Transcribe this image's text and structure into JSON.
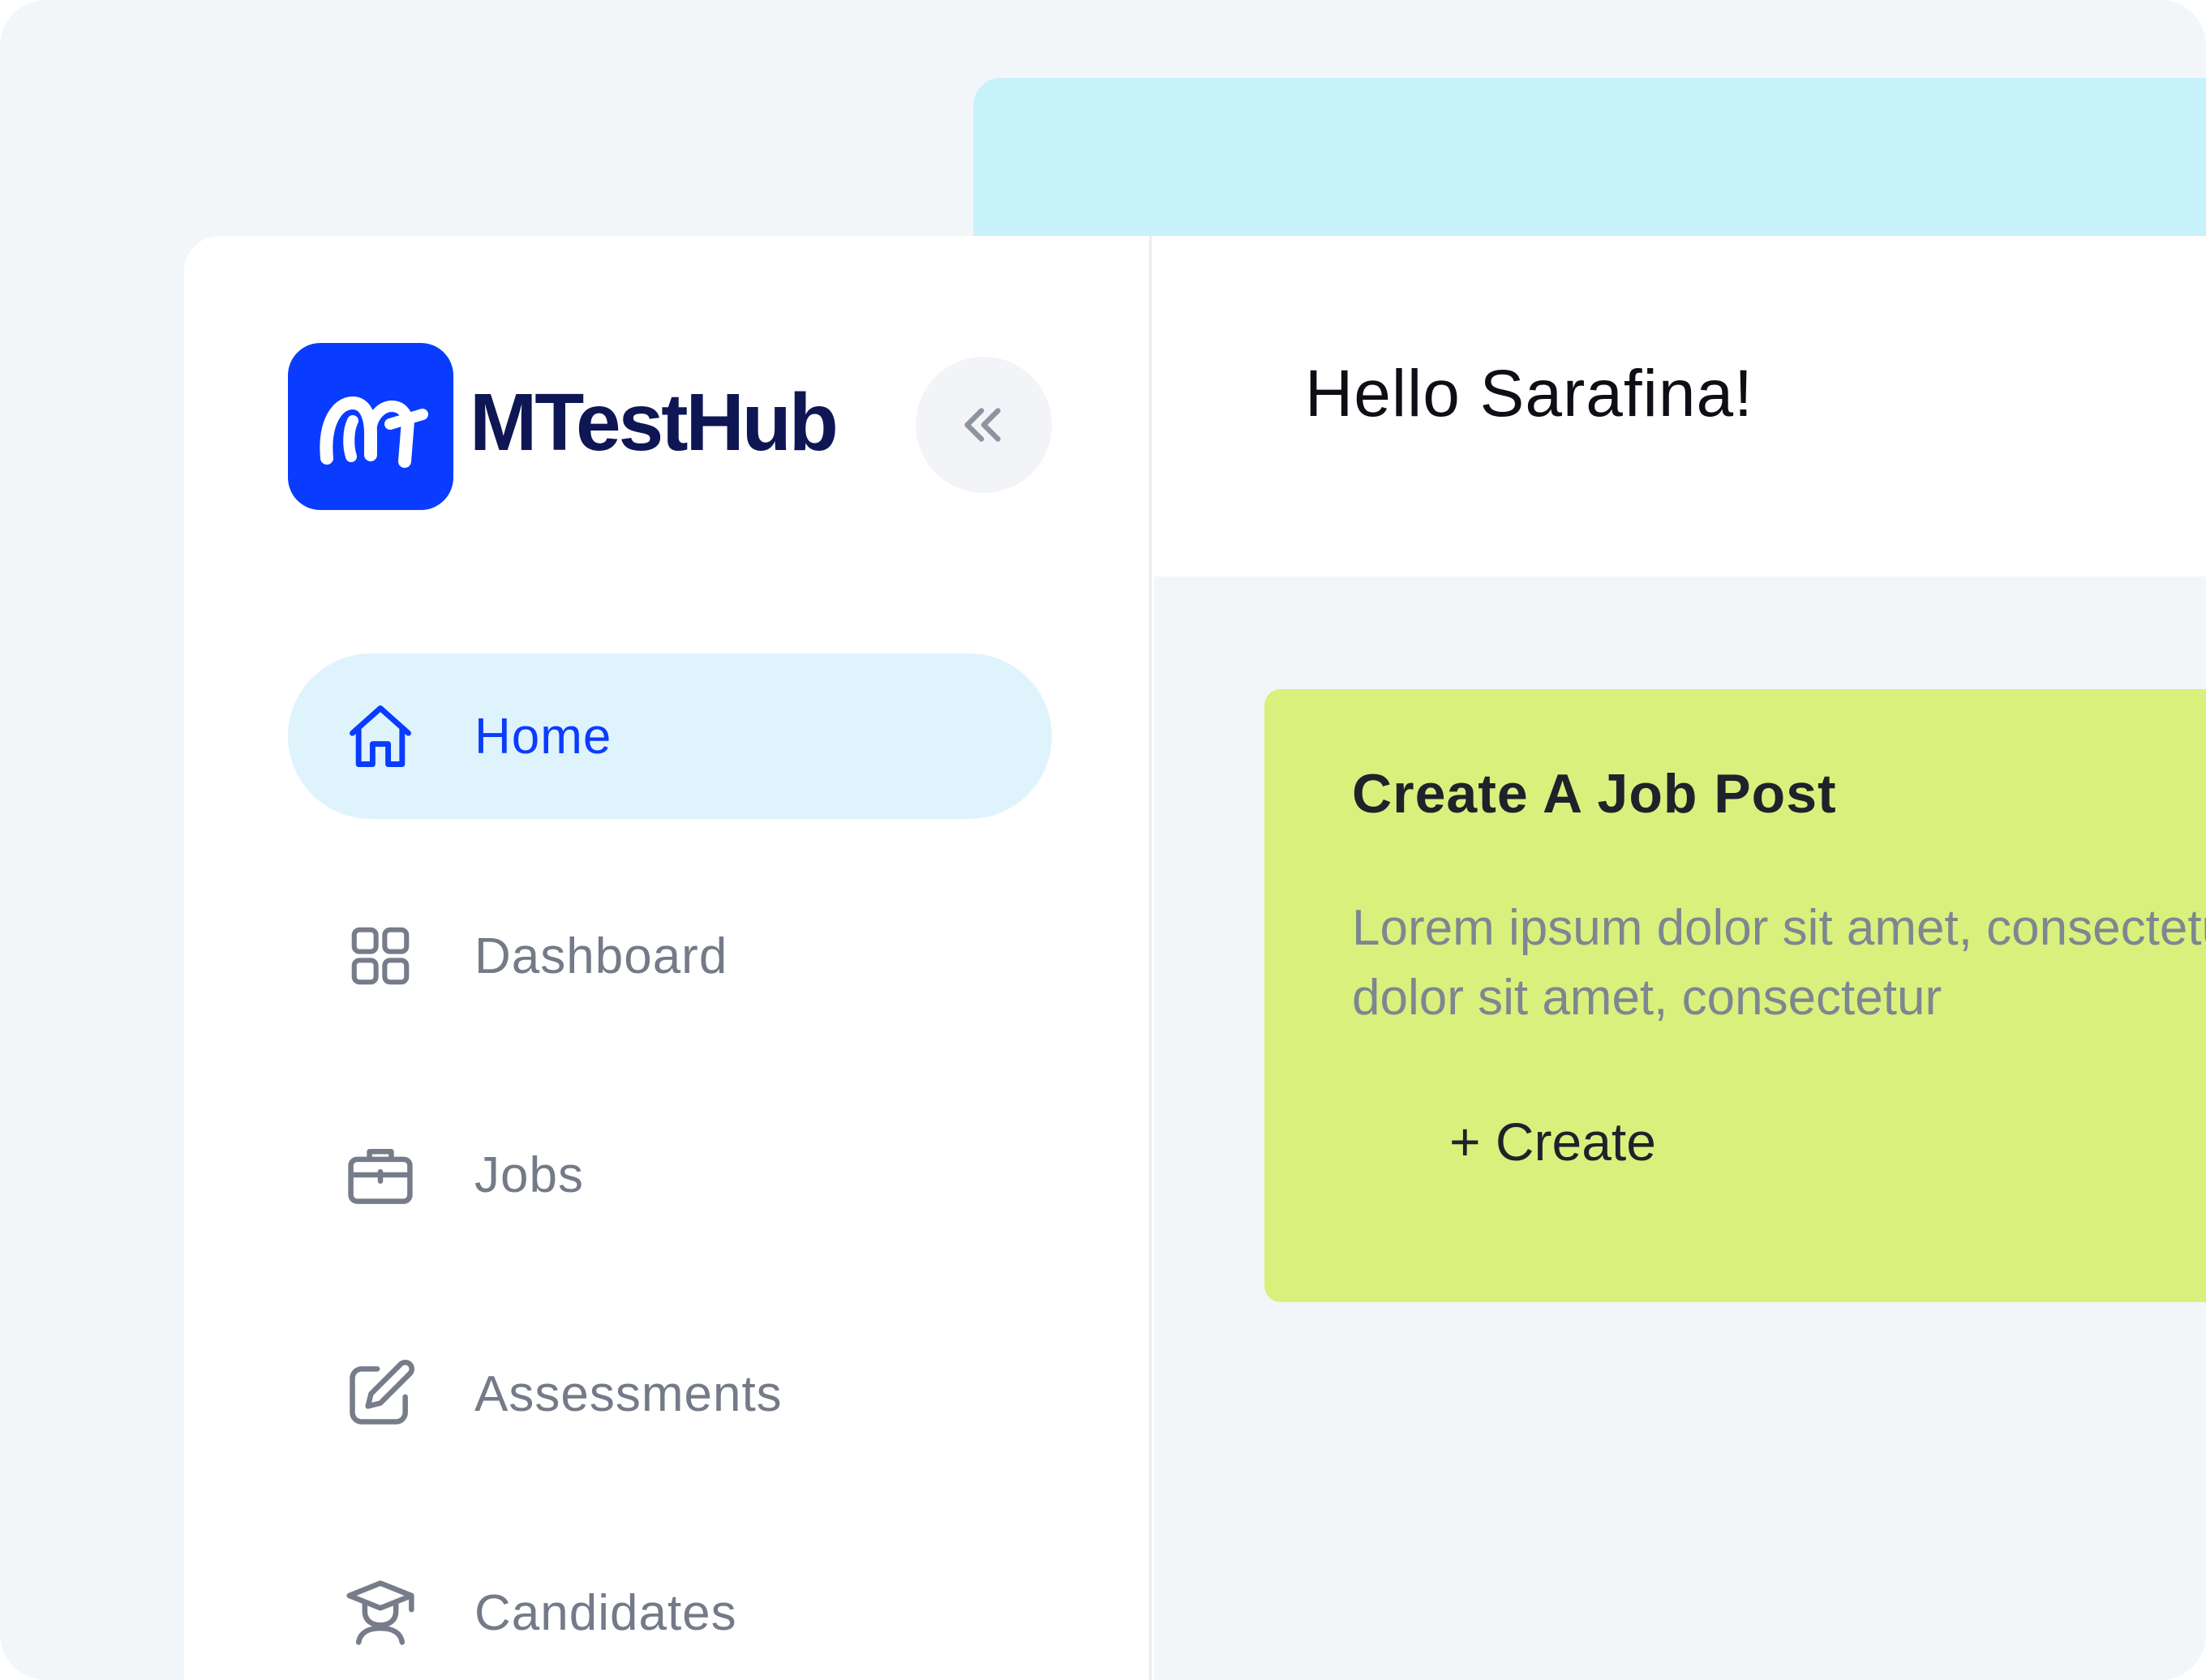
{
  "brand": {
    "name": "MTestHub",
    "icon": "mt-logo-icon",
    "color": "#0a3cff"
  },
  "sidebar": {
    "collapse_icon": "double-chevron-left-icon",
    "items": [
      {
        "label": "Home",
        "icon": "home-icon",
        "active": true
      },
      {
        "label": "Dashboard",
        "icon": "dashboard-grid-icon",
        "active": false
      },
      {
        "label": "Jobs",
        "icon": "briefcase-icon",
        "active": false
      },
      {
        "label": "Assessments",
        "icon": "edit-icon",
        "active": false
      },
      {
        "label": "Candidates",
        "icon": "graduate-icon",
        "active": false
      }
    ]
  },
  "header": {
    "greeting": "Hello Sarafina!"
  },
  "main": {
    "job_card": {
      "title": "Create A Job Post",
      "description_line1": "Lorem ipsum dolor sit amet, consectetur",
      "description_line2": "dolor sit amet, consectetur",
      "button_label": "+ Create",
      "background": "#daf07c"
    }
  },
  "colors": {
    "accent": "#0a3cff",
    "active_nav_bg": "#dff3fd",
    "cyan_band": "#c8f2f9"
  }
}
